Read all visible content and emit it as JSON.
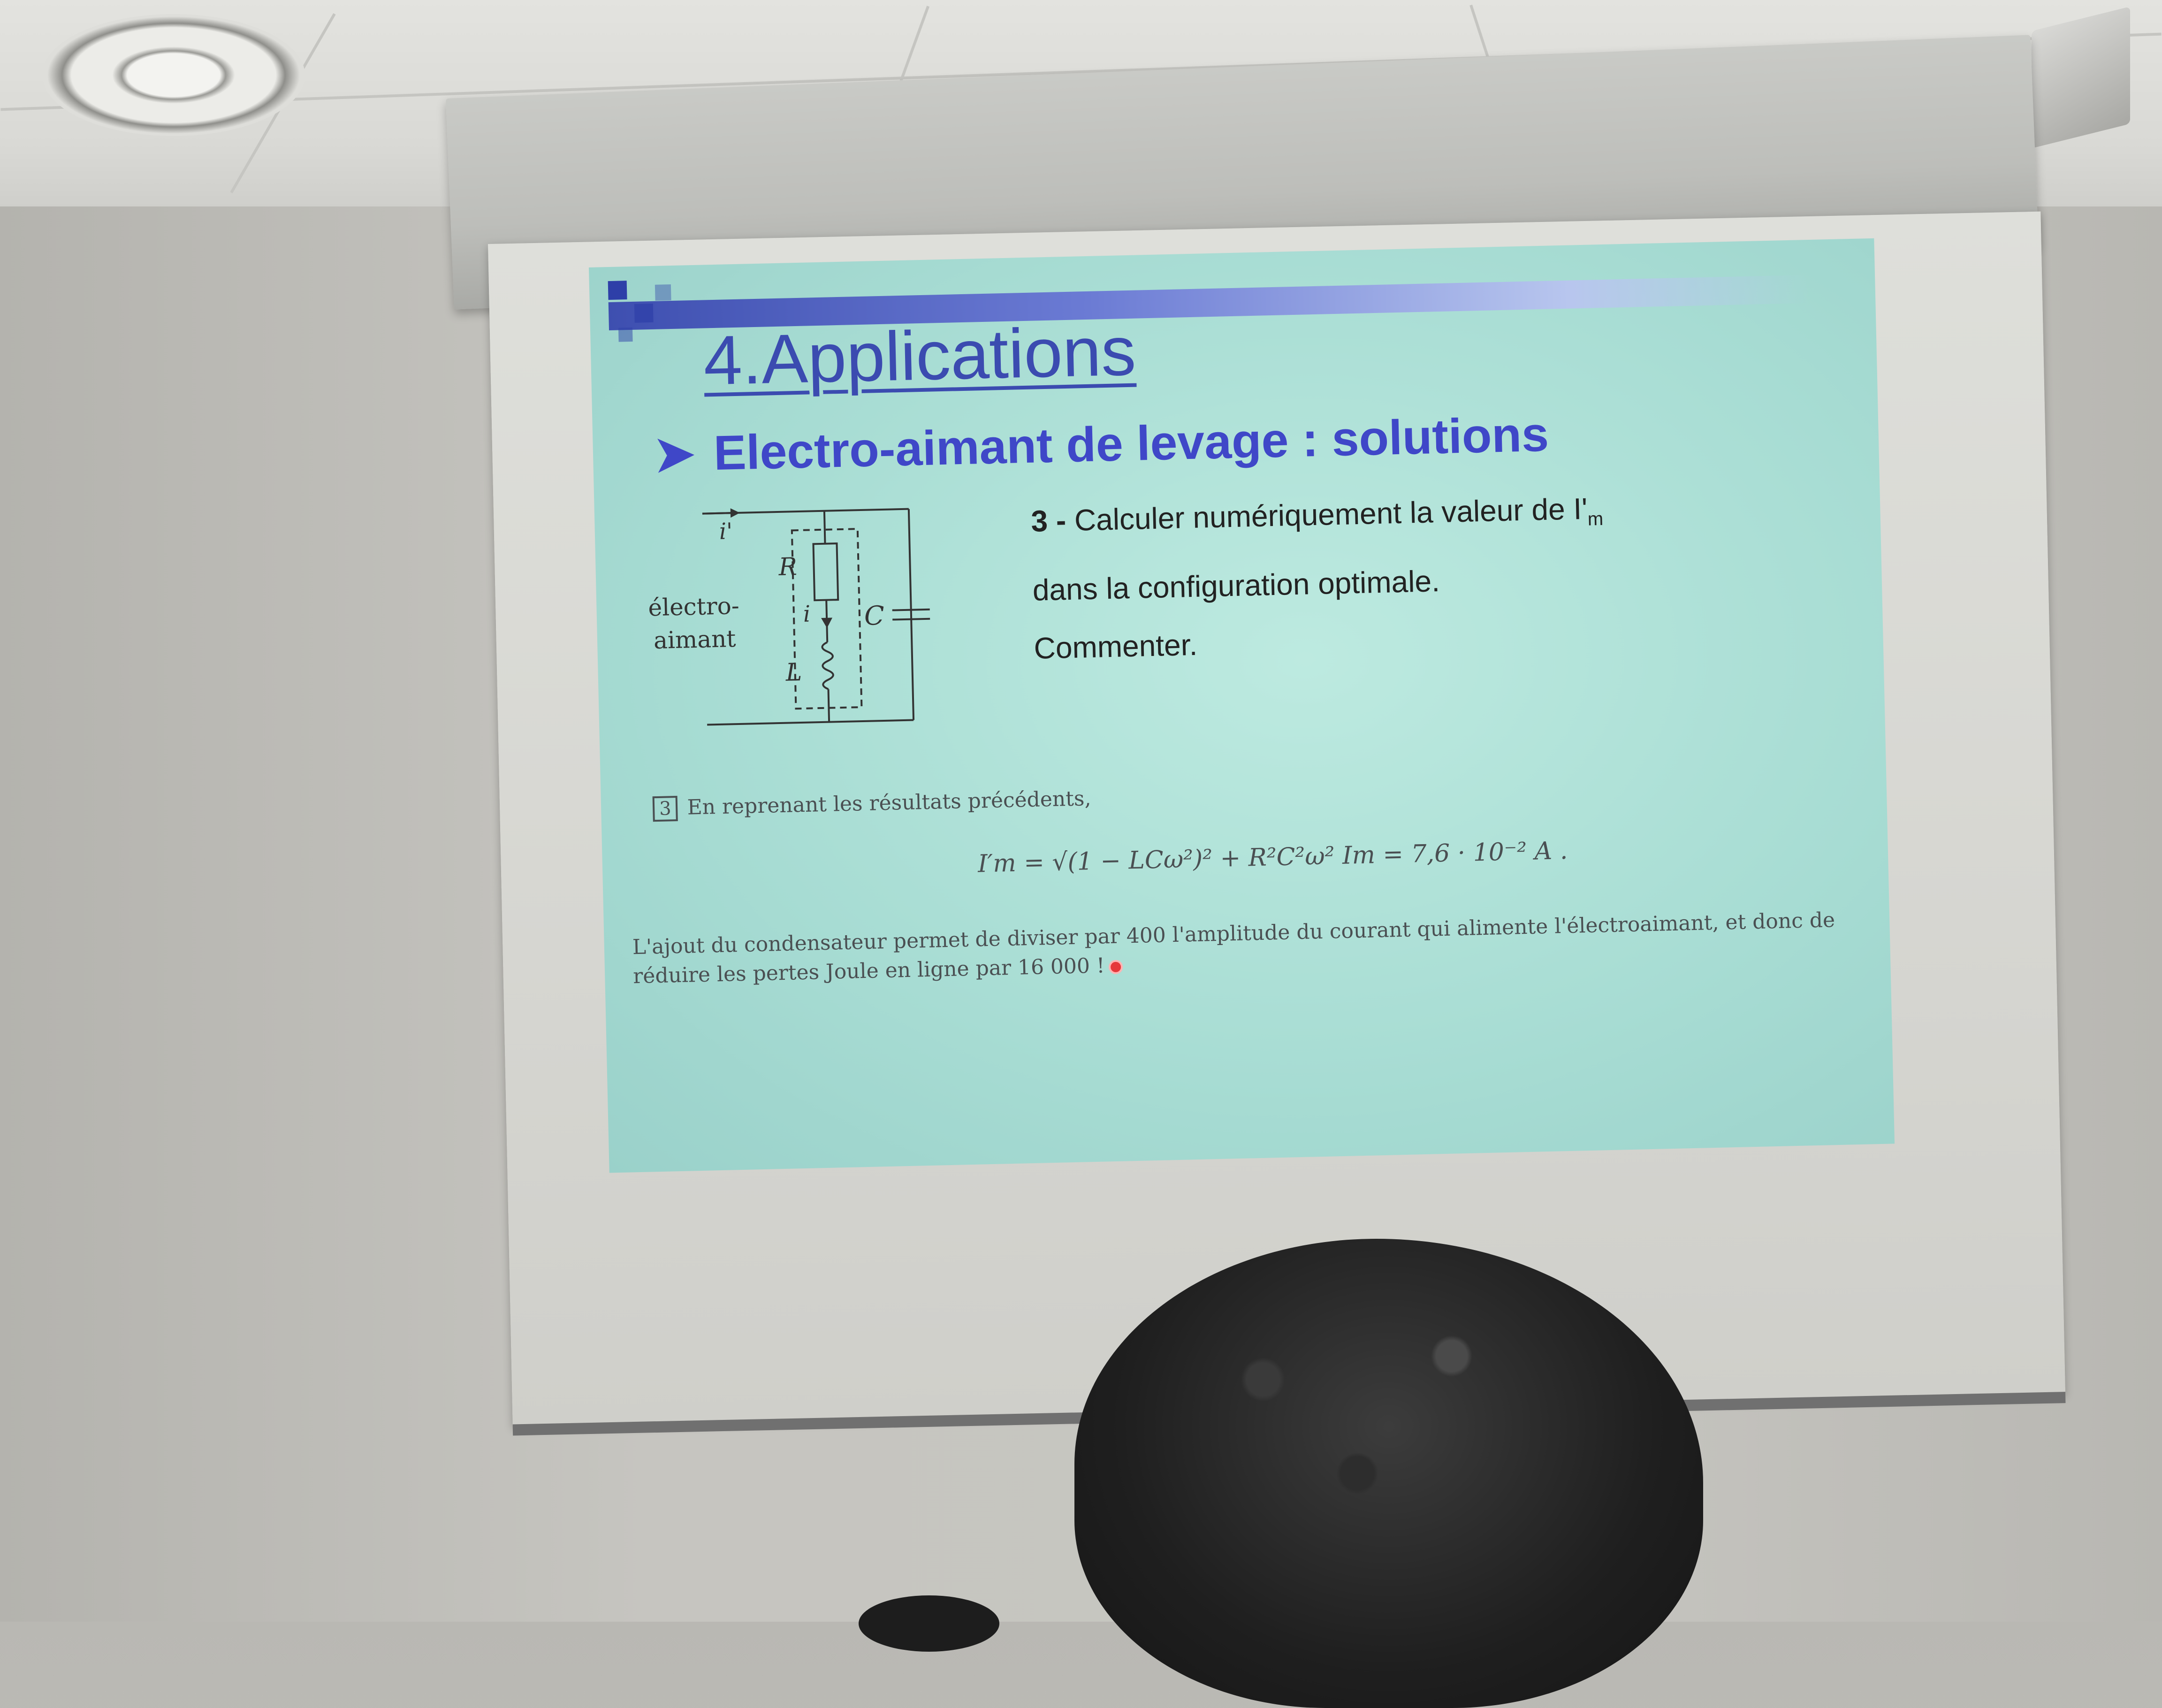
{
  "slide": {
    "title": "4.Applications",
    "subtitle": "Electro-aimant de levage : solutions",
    "question": {
      "number": "3 -",
      "line1": "Calculer numériquement la valeur de I'",
      "line1_sub": "m",
      "line2": "dans la configuration optimale.",
      "line3": "Commenter."
    },
    "circuit": {
      "current_in": "i'",
      "resistor": "R",
      "current": "i",
      "inductor": "L",
      "capacitor": "C",
      "label_line1": "électro-",
      "label_line2": "aimant"
    },
    "answer": {
      "box": "3",
      "intro": "En reprenant les résultats précédents,",
      "formula": "I′m = √(1 − LCω²)² + R²C²ω² Im = 7,6 · 10⁻² A .",
      "comment_line1": "L'ajout du condensateur permet de diviser par 400 l'amplitude du courant qui alimente l'électroaimant, et donc de",
      "comment_line2": "réduire les pertes Joule en ligne par 16 000 !"
    }
  },
  "colors": {
    "slide_background": "#a7dcd3",
    "title_blue": "#3b4bb0",
    "subtitle_blue": "#3f47c8",
    "pointer_red": "#e5383b"
  }
}
